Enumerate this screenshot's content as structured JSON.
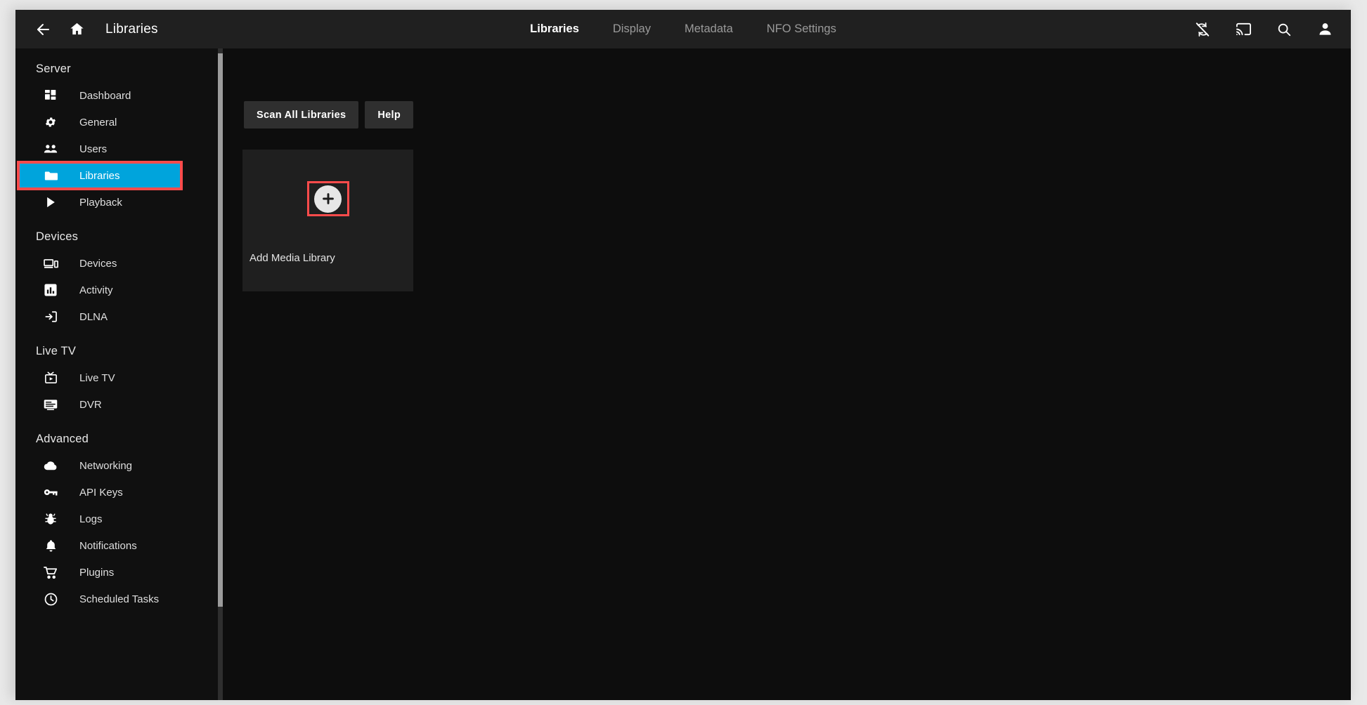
{
  "header": {
    "back_icon": "arrow-left-icon",
    "home_icon": "home-icon",
    "title": "Libraries",
    "tabs": [
      {
        "label": "Libraries",
        "active": true
      },
      {
        "label": "Display",
        "active": false
      },
      {
        "label": "Metadata",
        "active": false
      },
      {
        "label": "NFO Settings",
        "active": false
      }
    ],
    "right_icons": [
      {
        "name": "sync-disabled-icon"
      },
      {
        "name": "cast-icon"
      },
      {
        "name": "search-icon"
      },
      {
        "name": "user-account-icon"
      }
    ]
  },
  "sidebar": {
    "sections": [
      {
        "title": "Server",
        "items": [
          {
            "label": "Dashboard",
            "icon": "dashboard-icon",
            "active": false
          },
          {
            "label": "General",
            "icon": "gear-icon",
            "active": false
          },
          {
            "label": "Users",
            "icon": "users-icon",
            "active": false
          },
          {
            "label": "Libraries",
            "icon": "folder-icon",
            "active": true,
            "highlighted": true
          },
          {
            "label": "Playback",
            "icon": "play-icon",
            "active": false
          }
        ]
      },
      {
        "title": "Devices",
        "items": [
          {
            "label": "Devices",
            "icon": "devices-icon",
            "active": false
          },
          {
            "label": "Activity",
            "icon": "activity-chart-icon",
            "active": false
          },
          {
            "label": "DLNA",
            "icon": "dlna-input-icon",
            "active": false
          }
        ]
      },
      {
        "title": "Live TV",
        "items": [
          {
            "label": "Live TV",
            "icon": "live-tv-icon",
            "active": false
          },
          {
            "label": "DVR",
            "icon": "dvr-icon",
            "active": false
          }
        ]
      },
      {
        "title": "Advanced",
        "items": [
          {
            "label": "Networking",
            "icon": "cloud-icon",
            "active": false
          },
          {
            "label": "API Keys",
            "icon": "key-icon",
            "active": false
          },
          {
            "label": "Logs",
            "icon": "bug-icon",
            "active": false
          },
          {
            "label": "Notifications",
            "icon": "bell-icon",
            "active": false
          },
          {
            "label": "Plugins",
            "icon": "shopping-cart-icon",
            "active": false
          },
          {
            "label": "Scheduled Tasks",
            "icon": "clock-icon",
            "active": false
          }
        ]
      }
    ]
  },
  "main": {
    "buttons": [
      {
        "label": "Scan All Libraries"
      },
      {
        "label": "Help"
      }
    ],
    "add_card": {
      "label": "Add Media Library",
      "plus_icon": "plus-icon"
    }
  },
  "colors": {
    "accent": "#00a4dc",
    "highlight_outline": "#ff4b4b",
    "header_bg": "#202020",
    "sidebar_bg": "#101010",
    "content_bg": "#0d0d0d",
    "card_bg": "#1f1f1f",
    "button_bg": "#2f2f2f"
  }
}
